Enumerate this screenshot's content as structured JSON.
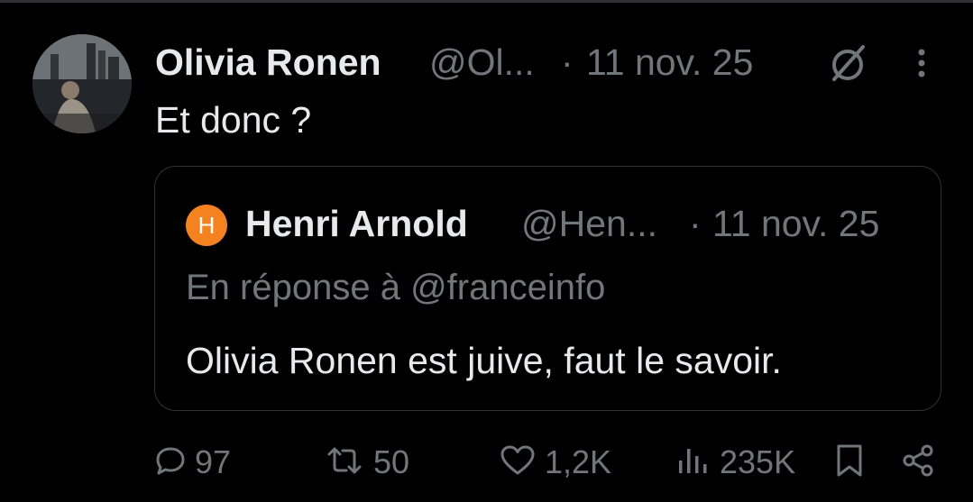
{
  "post": {
    "author_name": "Olivia Ronen",
    "author_handle": "@Ol...",
    "separator": "·",
    "date": "11 nov. 25",
    "text": "Et donc ?"
  },
  "quoted_post": {
    "avatar_letter": "H",
    "avatar_color": "#f4821f",
    "author_name": "Henri Arnold",
    "author_handle": "@Hen...",
    "separator": "·",
    "date": "11 nov. 25",
    "reply_context": "En réponse à @franceinfo",
    "text": "Olivia Ronen est juive, faut le savoir."
  },
  "actions": {
    "replies": "97",
    "reposts": "50",
    "likes": "1,2K",
    "views": "235K"
  },
  "icons": {
    "header": [
      "grok-icon",
      "more-options-icon"
    ],
    "actions": [
      "reply-icon",
      "repost-icon",
      "like-icon",
      "views-icon",
      "bookmark-icon",
      "share-icon"
    ]
  },
  "colors": {
    "background": "#000000",
    "text_primary": "#e7e9ea",
    "text_secondary": "#71767b",
    "border": "#2f3336"
  }
}
